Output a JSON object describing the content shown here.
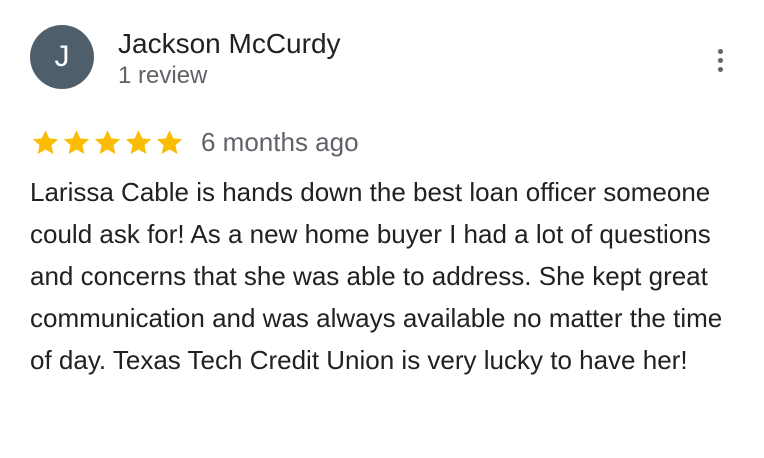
{
  "review": {
    "author": {
      "initial": "J",
      "name": "Jackson McCurdy",
      "review_count": "1 review",
      "avatar_color": "#4f5e6b"
    },
    "menu_icon": "more-vert-icon",
    "rating": 5,
    "rating_max": 5,
    "star_color": "#fbbc04",
    "date": "6 months ago",
    "text": "Larissa Cable is hands down the best loan officer someone could ask for! As a new home buyer I had a lot of questions and concerns that she was able to address. She kept great communication and was always available no matter the time of day. Texas Tech Credit Union is very lucky to have her!"
  }
}
